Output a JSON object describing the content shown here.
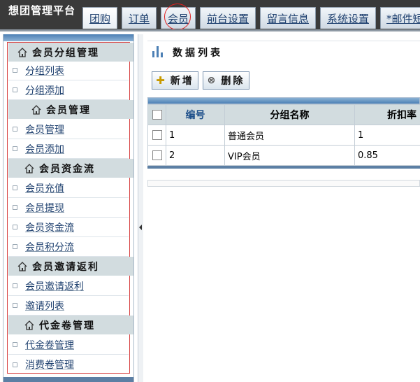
{
  "app": {
    "title": "想团管理平台"
  },
  "nav": {
    "tabs": [
      "团购",
      "订单",
      "会员",
      "前台设置",
      "留言信息",
      "系统设置",
      "*邮件短"
    ]
  },
  "sidebar": {
    "groups": [
      {
        "title": "会员分组管理",
        "items": [
          "分组列表",
          "分组添加"
        ]
      },
      {
        "title": "会员管理",
        "items": [
          "会员管理",
          "会员添加"
        ]
      },
      {
        "title": "会员资金流",
        "items": [
          "会员充值",
          "会员提现",
          "会员资金流",
          "会员积分流"
        ]
      },
      {
        "title": "会员邀请返利",
        "items": [
          "会员邀请返利",
          "邀请列表"
        ]
      },
      {
        "title": "代金卷管理",
        "items": [
          "代金卷管理",
          "消费卷管理"
        ]
      }
    ]
  },
  "main": {
    "title": "数据列表",
    "toolbar": {
      "add_label": "新增",
      "delete_label": "删除"
    },
    "table": {
      "headers": [
        "编号",
        "分组名称",
        "折扣率"
      ],
      "rows": [
        {
          "id": "1",
          "name": "普通会员",
          "discount": "1"
        },
        {
          "id": "2",
          "name": "VIP会员",
          "discount": "0.85"
        }
      ]
    }
  },
  "colors": {
    "topbar": "#3a3a3a",
    "header_bg": "#d2dcdf",
    "accent_blue": "#4d80b5",
    "highlight_red": "#d84444"
  }
}
